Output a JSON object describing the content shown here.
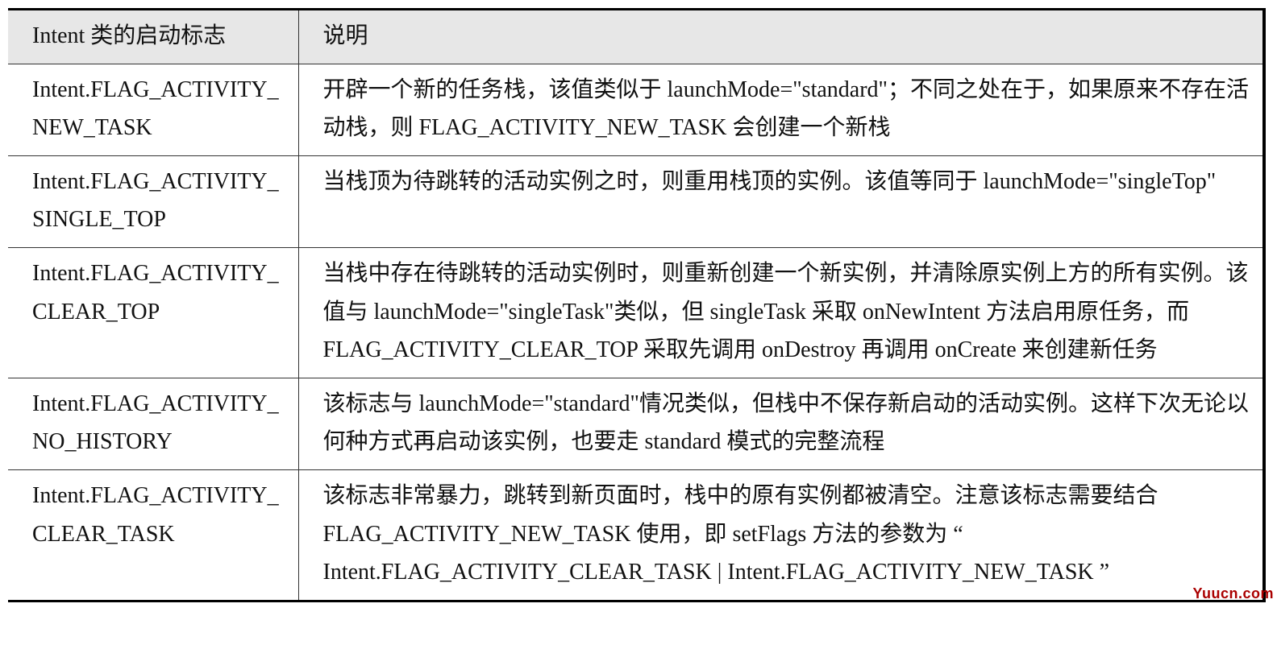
{
  "table": {
    "headers": {
      "flag": "Intent 类的启动标志",
      "desc": "说明"
    },
    "rows": [
      {
        "flag": "Intent.FLAG_ACTIVITY_NEW_TASK",
        "desc": "开辟一个新的任务栈，该值类似于 launchMode=\"standard\"；不同之处在于，如果原来不存在活动栈，则 FLAG_ACTIVITY_NEW_TASK 会创建一个新栈"
      },
      {
        "flag": "Intent.FLAG_ACTIVITY_SINGLE_TOP",
        "desc": "当栈顶为待跳转的活动实例之时，则重用栈顶的实例。该值等同于 launchMode=\"singleTop\""
      },
      {
        "flag": "Intent.FLAG_ACTIVITY_CLEAR_TOP",
        "desc": "当栈中存在待跳转的活动实例时，则重新创建一个新实例，并清除原实例上方的所有实例。该值与 launchMode=\"singleTask\"类似，但 singleTask 采取 onNewIntent 方法启用原任务，而 FLAG_ACTIVITY_CLEAR_TOP 采取先调用 onDestroy 再调用 onCreate 来创建新任务"
      },
      {
        "flag": "Intent.FLAG_ACTIVITY_NO_HISTORY",
        "desc": "该标志与 launchMode=\"standard\"情况类似，但栈中不保存新启动的活动实例。这样下次无论以何种方式再启动该实例，也要走 standard 模式的完整流程"
      },
      {
        "flag": "Intent.FLAG_ACTIVITY_CLEAR_TASK",
        "desc": "该标志非常暴力，跳转到新页面时，栈中的原有实例都被清空。注意该标志需要结合 FLAG_ACTIVITY_NEW_TASK 使用，即 setFlags 方法的参数为 “ Intent.FLAG_ACTIVITY_CLEAR_TASK | Intent.FLAG_ACTIVITY_NEW_TASK ”"
      }
    ]
  },
  "watermark": "Yuucn.com"
}
